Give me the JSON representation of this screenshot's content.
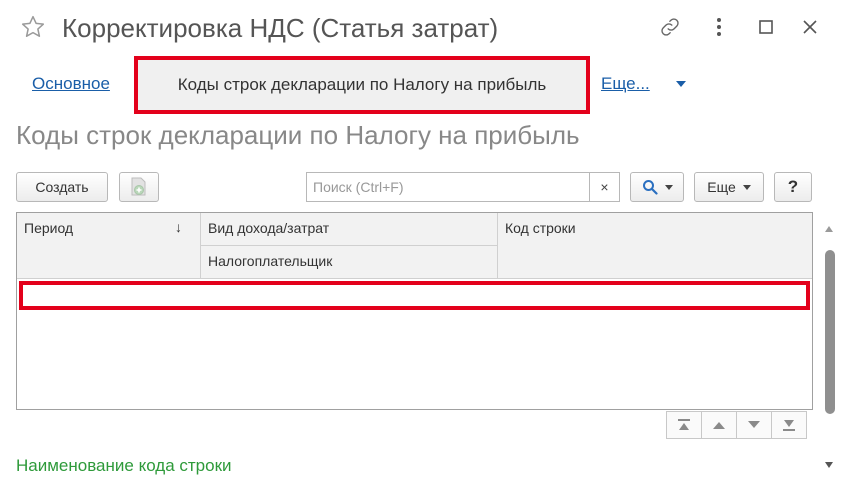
{
  "window": {
    "title": "Корректировка НДС (Статья затрат)",
    "icons": [
      "star-icon",
      "link-icon",
      "more-vertical-icon",
      "maximize-icon",
      "close-icon"
    ]
  },
  "nav": {
    "main_label": "Основное",
    "active_label": "Коды строк декларации по Налогу на прибыль",
    "more_label": "Еще..."
  },
  "section": {
    "title": "Коды строк декларации по Налогу на прибыль"
  },
  "toolbar": {
    "create_label": "Создать",
    "search_placeholder": "Поиск (Ctrl+F)",
    "clear_label": "×",
    "more_label": "Еще",
    "help_label": "?"
  },
  "table": {
    "columns": {
      "period": "Период",
      "income_expense_type": "Вид дохода/затрат",
      "taxpayer": "Налогоплательщик",
      "line_code": "Код строки"
    },
    "rows": []
  },
  "footer": {
    "line_name_label": "Наименование кода строки"
  },
  "colors": {
    "highlight": "#e3001b",
    "link": "#1a5ea8",
    "green": "#2e9a3a",
    "search_icon": "#2a6fc0"
  }
}
